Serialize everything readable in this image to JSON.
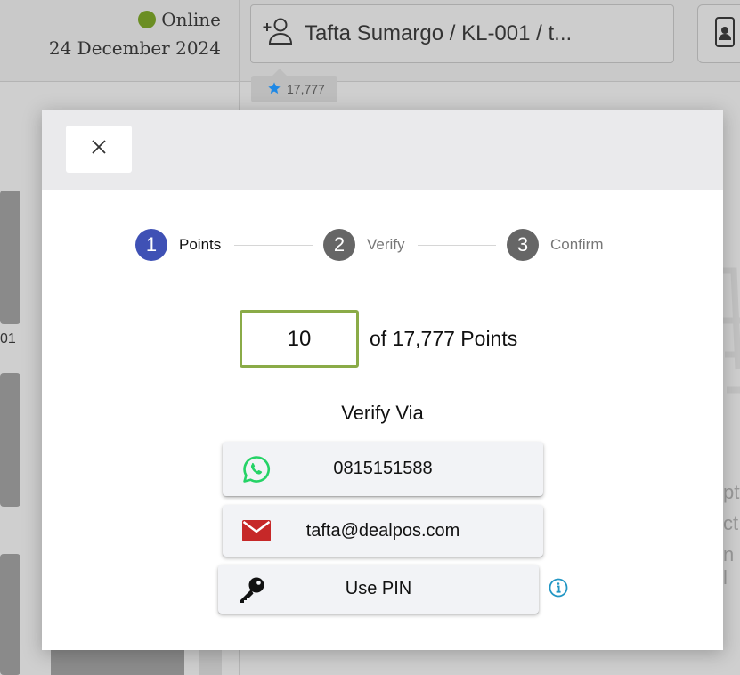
{
  "status": {
    "label": "Online",
    "date": "24 December 2024",
    "color": "#6b8e23"
  },
  "customer": {
    "label": "Tafta Sumargo / KL-001 / t..."
  },
  "points_badge": {
    "value": "17,777",
    "star_color": "#1e88e5"
  },
  "background_fragments": {
    "left_text": "01",
    "right_lines": [
      "pty",
      "ct",
      "n l"
    ]
  },
  "modal": {
    "steps": [
      {
        "number": "1",
        "label": "Points",
        "active": true
      },
      {
        "number": "2",
        "label": "Verify",
        "active": false
      },
      {
        "number": "3",
        "label": "Confirm",
        "active": false
      }
    ],
    "points_input": {
      "value": "10"
    },
    "points_total": "of 17,777 Points",
    "verify_title": "Verify Via",
    "options": {
      "whatsapp": {
        "label": "0815151588",
        "icon": "whatsapp-icon"
      },
      "email": {
        "label": "tafta@dealpos.com",
        "icon": "email-icon"
      },
      "pin": {
        "label": "Use PIN",
        "icon": "key-icon"
      }
    }
  },
  "colors": {
    "active_step": "#3f51b5",
    "inactive_step": "#666666",
    "input_border": "#8aab47",
    "whatsapp": "#25d366",
    "email": "#c62828",
    "info": "#2196c4"
  }
}
